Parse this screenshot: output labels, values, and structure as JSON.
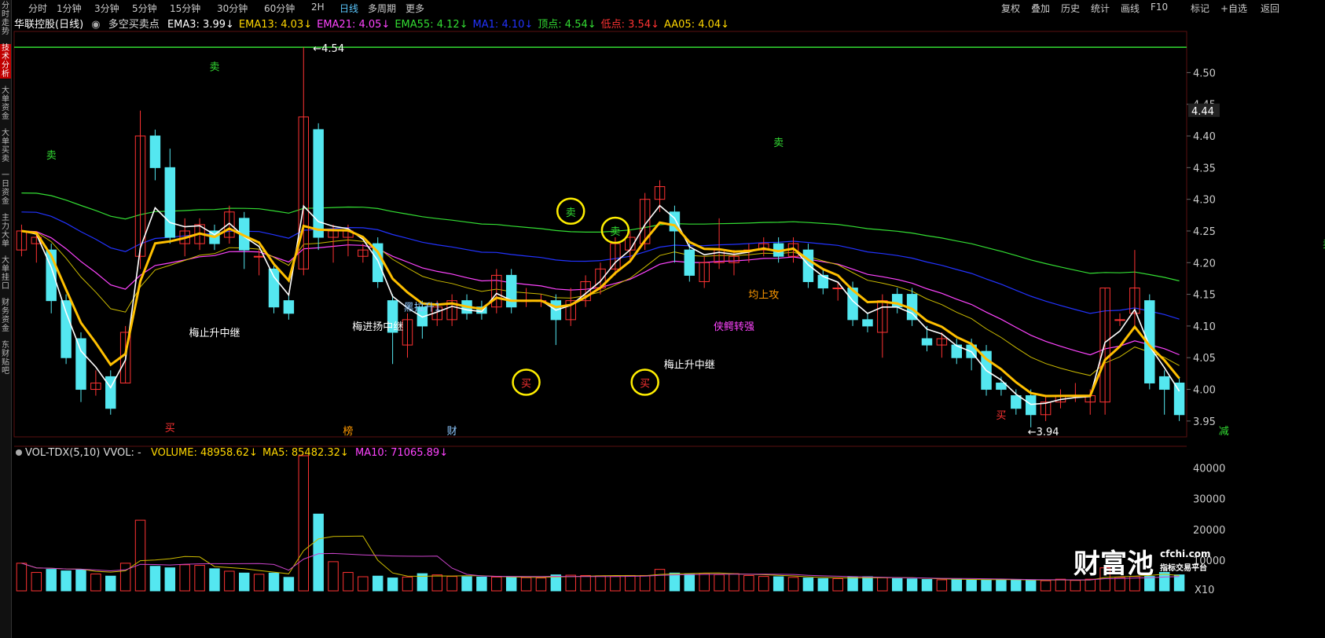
{
  "sidebar": {
    "tabs": [
      "分时走势",
      "技术分析",
      "大单资金",
      "大单买卖",
      "一日资金",
      "主力大单",
      "大单挂口",
      "财务资金",
      "东财贴吧"
    ],
    "active": 1
  },
  "timeframes": [
    "分时",
    "1分钟",
    "3分钟",
    "5分钟",
    "15分钟",
    "30分钟",
    "60分钟",
    "2H",
    "日线",
    "多周期",
    "更多"
  ],
  "active_timeframe": "日线",
  "toolbar": [
    "复权",
    "叠加",
    "历史",
    "统计",
    "画线",
    "F10",
    "标记",
    "+自选",
    "返回"
  ],
  "header": {
    "stock": "华联控股(日线)",
    "indicator": "多空买卖点",
    "items": [
      {
        "label": "EMA3: 3.99",
        "color": "#ffffff"
      },
      {
        "label": "EMA13: 4.03",
        "color": "#ffd700"
      },
      {
        "label": "EMA21: 4.05",
        "color": "#ff44ff"
      },
      {
        "label": "EMA55: 4.12",
        "color": "#33dd33"
      },
      {
        "label": "MA1: 4.10",
        "color": "#2233ff"
      },
      {
        "label": "顶点: 4.54",
        "color": "#33dd33"
      },
      {
        "label": "低点: 3.54",
        "color": "#ff3333"
      },
      {
        "label": "AA05: 4.04",
        "color": "#ffd700"
      }
    ]
  },
  "price_axis": [
    "4.50",
    "4.45",
    "4.40",
    "4.35",
    "4.30",
    "4.25",
    "4.20",
    "4.15",
    "4.10",
    "4.05",
    "4.00",
    "3.95"
  ],
  "price_range": [
    3.925,
    4.565
  ],
  "current_price": "4.44",
  "high_label": "4.54",
  "low_label": "3.94",
  "annotations": [
    {
      "text": "卖",
      "x": 2,
      "y": 4.37,
      "color": "#33dd33"
    },
    {
      "text": "卖",
      "x": 13,
      "y": 4.51,
      "color": "#33dd33"
    },
    {
      "text": "卖",
      "x": 37,
      "y": 4.28,
      "color": "#33dd33"
    },
    {
      "text": "卖",
      "x": 40,
      "y": 4.25,
      "color": "#33dd33"
    },
    {
      "text": "卖",
      "x": 51,
      "y": 4.39,
      "color": "#33dd33"
    },
    {
      "text": "卖",
      "x": 88,
      "y": 4.23,
      "color": "#33dd33"
    },
    {
      "text": "买",
      "x": 34,
      "y": 4.01,
      "color": "#ff3333"
    },
    {
      "text": "买",
      "x": 42,
      "y": 4.01,
      "color": "#ff3333"
    },
    {
      "text": "买",
      "x": 66,
      "y": 3.96,
      "color": "#ff3333"
    },
    {
      "text": "梅止升中继",
      "x": 13,
      "y": 4.09,
      "color": "#ffffff"
    },
    {
      "text": "梅进扬中继",
      "x": 24,
      "y": 4.1,
      "color": "#ffffff"
    },
    {
      "text": "黑拉升1",
      "x": 27,
      "y": 4.13,
      "color": "#8ec8ff"
    },
    {
      "text": "梅止升中继",
      "x": 45,
      "y": 4.04,
      "color": "#ffffff"
    },
    {
      "text": "均上攻",
      "x": 50,
      "y": 4.15,
      "color": "#ff9900"
    },
    {
      "text": "侠鳄转强",
      "x": 48,
      "y": 4.1,
      "color": "#ff44ff"
    },
    {
      "text": "买",
      "x": 10,
      "y": 3.94,
      "color": "#ff3333"
    },
    {
      "text": "榜",
      "x": 22,
      "y": 3.935,
      "color": "#ff9900"
    },
    {
      "text": "财",
      "x": 29,
      "y": 3.935,
      "color": "#8ec8ff"
    },
    {
      "text": "减",
      "x": 81,
      "y": 3.935,
      "color": "#33dd33"
    }
  ],
  "circled": [
    {
      "x": 37,
      "y": 4.28
    },
    {
      "x": 40,
      "y": 4.25
    },
    {
      "x": 34,
      "y": 4.01
    },
    {
      "x": 42,
      "y": 4.01
    }
  ],
  "candles": [
    [
      4.22,
      4.25,
      4.26,
      4.21
    ],
    [
      4.23,
      4.24,
      4.25,
      4.2
    ],
    [
      4.22,
      4.14,
      4.23,
      4.12
    ],
    [
      4.14,
      4.05,
      4.15,
      4.04
    ],
    [
      4.08,
      4.0,
      4.09,
      3.98
    ],
    [
      4.0,
      4.01,
      4.03,
      3.99
    ],
    [
      4.02,
      3.97,
      4.03,
      3.96
    ],
    [
      4.01,
      4.09,
      4.1,
      4.01
    ],
    [
      4.21,
      4.4,
      4.44,
      4.19
    ],
    [
      4.4,
      4.35,
      4.41,
      4.33
    ],
    [
      4.35,
      4.24,
      4.38,
      4.23
    ],
    [
      4.23,
      4.25,
      4.27,
      4.21
    ],
    [
      4.23,
      4.26,
      4.27,
      4.22
    ],
    [
      4.25,
      4.23,
      4.26,
      4.22
    ],
    [
      4.24,
      4.28,
      4.29,
      4.23
    ],
    [
      4.27,
      4.22,
      4.28,
      4.19
    ],
    [
      4.21,
      4.21,
      4.22,
      4.18
    ],
    [
      4.19,
      4.13,
      4.2,
      4.12
    ],
    [
      4.14,
      4.12,
      4.15,
      4.11
    ],
    [
      4.19,
      4.43,
      4.54,
      4.18
    ],
    [
      4.41,
      4.24,
      4.42,
      4.22
    ],
    [
      4.24,
      4.25,
      4.26,
      4.2
    ],
    [
      4.24,
      4.25,
      4.26,
      4.21
    ],
    [
      4.21,
      4.22,
      4.23,
      4.2
    ],
    [
      4.23,
      4.17,
      4.24,
      4.16
    ],
    [
      4.14,
      4.09,
      4.15,
      4.04
    ],
    [
      4.07,
      4.11,
      4.12,
      4.05
    ],
    [
      4.13,
      4.1,
      4.14,
      4.08
    ],
    [
      4.11,
      4.13,
      4.14,
      4.1
    ],
    [
      4.11,
      4.14,
      4.15,
      4.1
    ],
    [
      4.14,
      4.12,
      4.15,
      4.11
    ],
    [
      4.13,
      4.12,
      4.14,
      4.11
    ],
    [
      4.13,
      4.18,
      4.19,
      4.12
    ],
    [
      4.18,
      4.13,
      4.19,
      4.12
    ],
    [
      4.14,
      4.14,
      4.16,
      4.13
    ],
    [
      4.14,
      4.14,
      4.15,
      4.13
    ],
    [
      4.14,
      4.11,
      4.15,
      4.07
    ],
    [
      4.11,
      4.14,
      4.16,
      4.1
    ],
    [
      4.14,
      4.17,
      4.18,
      4.13
    ],
    [
      4.16,
      4.19,
      4.2,
      4.15
    ],
    [
      4.19,
      4.23,
      4.24,
      4.18
    ],
    [
      4.22,
      4.24,
      4.25,
      4.2
    ],
    [
      4.23,
      4.3,
      4.31,
      4.22
    ],
    [
      4.3,
      4.32,
      4.33,
      4.28
    ],
    [
      4.28,
      4.25,
      4.29,
      4.2
    ],
    [
      4.22,
      4.18,
      4.23,
      4.17
    ],
    [
      4.17,
      4.2,
      4.21,
      4.16
    ],
    [
      4.2,
      4.22,
      4.27,
      4.19
    ],
    [
      4.2,
      4.21,
      4.22,
      4.18
    ],
    [
      4.22,
      4.22,
      4.23,
      4.2
    ],
    [
      4.22,
      4.23,
      4.24,
      4.21
    ],
    [
      4.23,
      4.21,
      4.24,
      4.2
    ],
    [
      4.21,
      4.23,
      4.24,
      4.2
    ],
    [
      4.22,
      4.17,
      4.23,
      4.16
    ],
    [
      4.18,
      4.16,
      4.19,
      4.15
    ],
    [
      4.16,
      4.16,
      4.17,
      4.14
    ],
    [
      4.16,
      4.11,
      4.17,
      4.1
    ],
    [
      4.11,
      4.1,
      4.12,
      4.09
    ],
    [
      4.09,
      4.14,
      4.15,
      4.05
    ],
    [
      4.15,
      4.13,
      4.16,
      4.12
    ],
    [
      4.15,
      4.11,
      4.16,
      4.1
    ],
    [
      4.08,
      4.07,
      4.1,
      4.06
    ],
    [
      4.07,
      4.08,
      4.09,
      4.05
    ],
    [
      4.07,
      4.05,
      4.08,
      4.04
    ],
    [
      4.07,
      4.05,
      4.08,
      4.03
    ],
    [
      4.06,
      4.0,
      4.07,
      3.99
    ],
    [
      4.01,
      4.0,
      4.02,
      3.99
    ],
    [
      3.99,
      3.97,
      4.0,
      3.96
    ],
    [
      3.99,
      3.96,
      4.0,
      3.94
    ],
    [
      3.96,
      3.98,
      3.99,
      3.95
    ],
    [
      3.98,
      3.99,
      4.0,
      3.97
    ],
    [
      3.99,
      3.99,
      4.01,
      3.98
    ],
    [
      3.98,
      3.99,
      4.0,
      3.96
    ],
    [
      3.98,
      4.16,
      4.16,
      3.96
    ],
    [
      4.11,
      4.11,
      4.12,
      4.1
    ],
    [
      4.12,
      4.16,
      4.22,
      4.1
    ],
    [
      4.14,
      4.01,
      4.15,
      4.0
    ],
    [
      4.02,
      4.0,
      4.03,
      3.96
    ],
    [
      4.01,
      3.96,
      4.02,
      3.95
    ]
  ],
  "volume": {
    "title": "VOL-TDX(5,10) VVOL: -",
    "items": [
      {
        "label": "VOLUME: 48958.62",
        "color": "#ffd700"
      },
      {
        "label": "MA5: 85482.32",
        "color": "#ffd700"
      },
      {
        "label": "MA10: 71065.89",
        "color": "#ff44ff"
      }
    ],
    "axis": [
      "40000",
      "30000",
      "20000",
      "10000"
    ],
    "axis_range": [
      0,
      44000
    ],
    "multiplier": "X10",
    "values": [
      9000,
      6000,
      7000,
      6500,
      6800,
      5500,
      4800,
      9000,
      23000,
      8000,
      7500,
      8500,
      8300,
      7200,
      6400,
      5800,
      5400,
      5800,
      4400,
      44000,
      25000,
      9500,
      6000,
      4600,
      4800,
      4200,
      4500,
      5600,
      5200,
      4700,
      4600,
      4500,
      4500,
      4400,
      4300,
      4200,
      5200,
      5100,
      5000,
      4900,
      4800,
      5000,
      5000,
      7000,
      5800,
      5400,
      5700,
      5300,
      5600,
      5000,
      4700,
      4600,
      4400,
      4200,
      4000,
      4000,
      4500,
      4600,
      4300,
      4000,
      3900,
      3700,
      3600,
      3800,
      3600,
      3500,
      3700,
      3600,
      3400,
      3300,
      3800,
      3400,
      3800,
      7500,
      4400,
      4700,
      4700,
      6000,
      5200
    ]
  },
  "watermark": {
    "brand": "财富池",
    "site": "cfchi.com",
    "tag": "指标交易平台"
  }
}
